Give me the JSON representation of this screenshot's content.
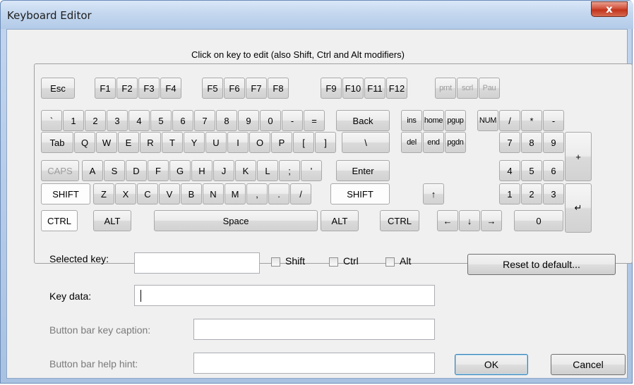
{
  "window": {
    "title": "Keyboard Editor",
    "close_glyph": "x"
  },
  "keyboard": {
    "title": "Click on key to edit (also Shift, Ctrl and Alt modifiers)",
    "keys": [
      {
        "label": "Esc"
      },
      {
        "label": "F1"
      },
      {
        "label": "F2"
      },
      {
        "label": "F3"
      },
      {
        "label": "F4"
      },
      {
        "label": "F5"
      },
      {
        "label": "F6"
      },
      {
        "label": "F7"
      },
      {
        "label": "F8"
      },
      {
        "label": "F9"
      },
      {
        "label": "F10"
      },
      {
        "label": "F11"
      },
      {
        "label": "F12"
      },
      {
        "label": "prnt"
      },
      {
        "label": "scrl"
      },
      {
        "label": "Pau"
      },
      {
        "label": "`"
      },
      {
        "label": "1"
      },
      {
        "label": "2"
      },
      {
        "label": "3"
      },
      {
        "label": "4"
      },
      {
        "label": "5"
      },
      {
        "label": "6"
      },
      {
        "label": "7"
      },
      {
        "label": "8"
      },
      {
        "label": "9"
      },
      {
        "label": "0"
      },
      {
        "label": "-"
      },
      {
        "label": "="
      },
      {
        "label": "Back"
      },
      {
        "label": "ins"
      },
      {
        "label": "home"
      },
      {
        "label": "pgup"
      },
      {
        "label": "NUM"
      },
      {
        "label": "/"
      },
      {
        "label": "*"
      },
      {
        "label": "-"
      },
      {
        "label": "Tab"
      },
      {
        "label": "Q"
      },
      {
        "label": "W"
      },
      {
        "label": "E"
      },
      {
        "label": "R"
      },
      {
        "label": "T"
      },
      {
        "label": "Y"
      },
      {
        "label": "U"
      },
      {
        "label": "I"
      },
      {
        "label": "O"
      },
      {
        "label": "P"
      },
      {
        "label": "["
      },
      {
        "label": "]"
      },
      {
        "label": "\\"
      },
      {
        "label": "del"
      },
      {
        "label": "end"
      },
      {
        "label": "pgdn"
      },
      {
        "label": "7"
      },
      {
        "label": "8"
      },
      {
        "label": "9"
      },
      {
        "label": "+"
      },
      {
        "label": "CAPS"
      },
      {
        "label": "A"
      },
      {
        "label": "S"
      },
      {
        "label": "D"
      },
      {
        "label": "F"
      },
      {
        "label": "G"
      },
      {
        "label": "H"
      },
      {
        "label": "J"
      },
      {
        "label": "K"
      },
      {
        "label": "L"
      },
      {
        "label": ";"
      },
      {
        "label": "'"
      },
      {
        "label": "Enter"
      },
      {
        "label": "4"
      },
      {
        "label": "5"
      },
      {
        "label": "6"
      },
      {
        "label": "SHIFT"
      },
      {
        "label": "Z"
      },
      {
        "label": "X"
      },
      {
        "label": "C"
      },
      {
        "label": "V"
      },
      {
        "label": "B"
      },
      {
        "label": "N"
      },
      {
        "label": "M"
      },
      {
        "label": ","
      },
      {
        "label": "."
      },
      {
        "label": "/"
      },
      {
        "label": "SHIFT"
      },
      {
        "label": "↑"
      },
      {
        "label": "1"
      },
      {
        "label": "2"
      },
      {
        "label": "3"
      },
      {
        "label": "↵"
      },
      {
        "label": "CTRL"
      },
      {
        "label": "ALT"
      },
      {
        "label": "Space"
      },
      {
        "label": "ALT"
      },
      {
        "label": "CTRL"
      },
      {
        "label": "←"
      },
      {
        "label": "↓"
      },
      {
        "label": "→"
      },
      {
        "label": "0"
      },
      {
        "label": "."
      }
    ]
  },
  "form": {
    "selected_key_label": "Selected key:",
    "selected_key_value": "",
    "shift_label": "Shift",
    "ctrl_label": "Ctrl",
    "alt_label": "Alt",
    "reset_label": "Reset to default...",
    "key_data_label": "Key data:",
    "key_data_value": "",
    "caption_label": "Button bar key caption:",
    "caption_value": "",
    "hint_label": "Button bar help hint:",
    "hint_value": "",
    "ok_label": "OK",
    "cancel_label": "Cancel"
  }
}
